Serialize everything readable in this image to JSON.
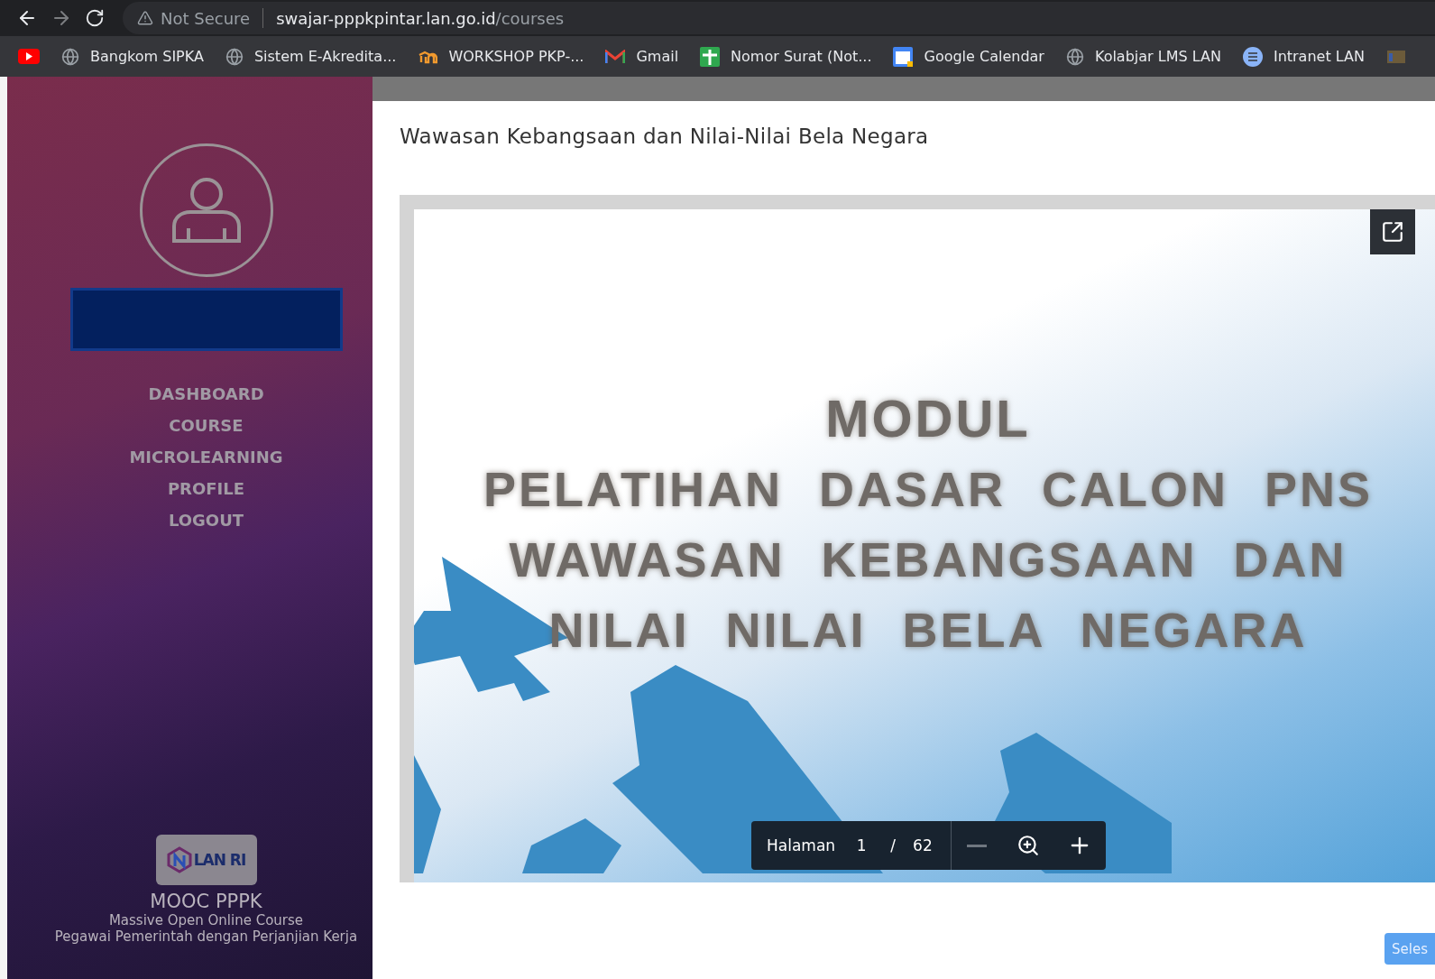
{
  "browser": {
    "nav_buttons": [
      {
        "kind": "back",
        "disabled": false
      },
      {
        "kind": "forward",
        "disabled": true
      },
      {
        "kind": "reload",
        "disabled": false
      }
    ],
    "security": "Not Secure",
    "url_host": "swajar-pppkpintar.lan.go.id",
    "url_path": "/courses"
  },
  "bookmarks": [
    {
      "kind": "youtube"
    },
    {
      "kind": "globe",
      "label": "Bangkom SIPKA"
    },
    {
      "kind": "globe",
      "label": "Sistem E-Akredita..."
    },
    {
      "kind": "moodle",
      "label": "WORKSHOP PKP-..."
    },
    {
      "kind": "mail",
      "label": "Gmail"
    },
    {
      "kind": "sheet",
      "label": "Nomor Surat (Not..."
    },
    {
      "kind": "calendar",
      "label": "Google Calendar"
    },
    {
      "kind": "globe",
      "label": "Kolabjar LMS LAN"
    },
    {
      "kind": "list",
      "label": "Intranet LAN"
    },
    {
      "kind": "app"
    }
  ],
  "sidebar": {
    "menu": [
      "DASHBOARD",
      "COURSE",
      "MICROLEARNING",
      "PROFILE",
      "LOGOUT"
    ],
    "logo_text": "LAN RI",
    "title": "MOOC PPPK",
    "subtitle": "Massive Open Online Course",
    "tagline": "Pegawai Pemerintah dengan Perjanjian Kerja"
  },
  "course": {
    "title": "Wawasan Kebangsaan dan Nilai-Nilai Bela Negara",
    "slide_lines": [
      "MODUL",
      "PELATIHAN DASAR CALON PNS",
      "WAWASAN KEBANGSAAN DAN",
      "NILAI NILAI BELA NEGARA"
    ],
    "toolbar": {
      "label": "Halaman",
      "page": "1",
      "separator": "/",
      "total": "62",
      "buttons": [
        {
          "kind": "zoom_out",
          "disabled": true
        },
        {
          "kind": "zoom",
          "disabled": false
        },
        {
          "kind": "zoom_in",
          "disabled": false
        }
      ]
    },
    "finish_button": "Seles"
  }
}
